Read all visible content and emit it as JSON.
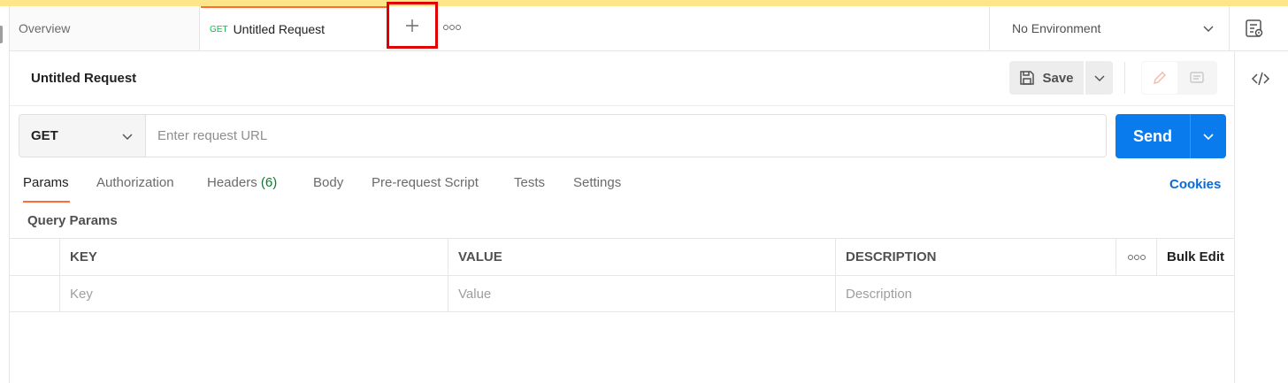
{
  "tabs": {
    "overview_label": "Overview",
    "active_method": "GET",
    "active_title": "Untitled Request"
  },
  "environment": {
    "selected": "No Environment"
  },
  "request": {
    "title": "Untitled Request",
    "save_label": "Save",
    "method": "GET",
    "url_placeholder": "Enter request URL",
    "send_label": "Send"
  },
  "request_tabs": {
    "params": "Params",
    "authorization": "Authorization",
    "headers": "Headers",
    "headers_count": "(6)",
    "body": "Body",
    "prerequest": "Pre-request Script",
    "tests": "Tests",
    "settings": "Settings",
    "cookies": "Cookies"
  },
  "query_params": {
    "title": "Query Params",
    "headers": {
      "key": "KEY",
      "value": "VALUE",
      "description": "DESCRIPTION",
      "bulk_edit": "Bulk Edit"
    },
    "placeholders": {
      "key": "Key",
      "value": "Value",
      "description": "Description"
    }
  },
  "colors": {
    "accent": "#ff6c37",
    "send": "#097bed",
    "link": "#0b6ad8",
    "highlight_box": "#e00000",
    "top_strip": "#fde68a"
  },
  "icons": [
    "plus-icon",
    "more-icon",
    "chevron-down-icon",
    "environment-settings-icon",
    "code-icon",
    "save-icon",
    "edit-icon",
    "comment-icon"
  ]
}
